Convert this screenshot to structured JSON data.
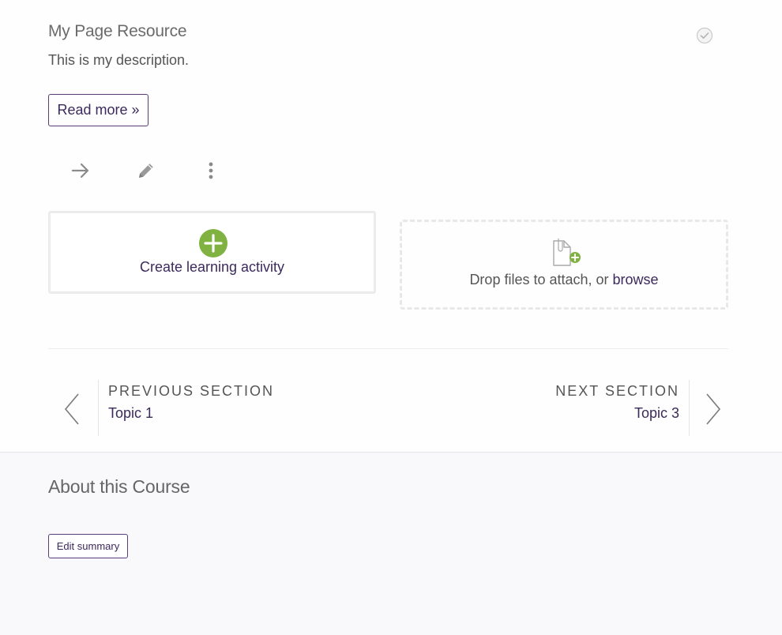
{
  "resource": {
    "title": "My Page Resource",
    "description": "This is my description.",
    "read_more_label": "Read more »"
  },
  "toolbar": {
    "move_icon": "arrow-right-icon",
    "edit_icon": "pencil-icon",
    "more_icon": "more-vertical-icon"
  },
  "create_activity": {
    "label": "Create learning activity",
    "icon": "plus-circle-icon"
  },
  "drop_files": {
    "text": "Drop files to attach, or ",
    "browse_label": "browse",
    "icon": "file-add-icon"
  },
  "section_nav": {
    "previous_heading": "PREVIOUS SECTION",
    "previous_topic": "Topic 1",
    "next_heading": "NEXT SECTION",
    "next_topic": "Topic 3"
  },
  "about": {
    "title": "About this Course",
    "edit_summary_label": "Edit summary"
  },
  "colors": {
    "accent": "#3b2a5c",
    "green": "#7fb241",
    "border": "#ececec"
  }
}
